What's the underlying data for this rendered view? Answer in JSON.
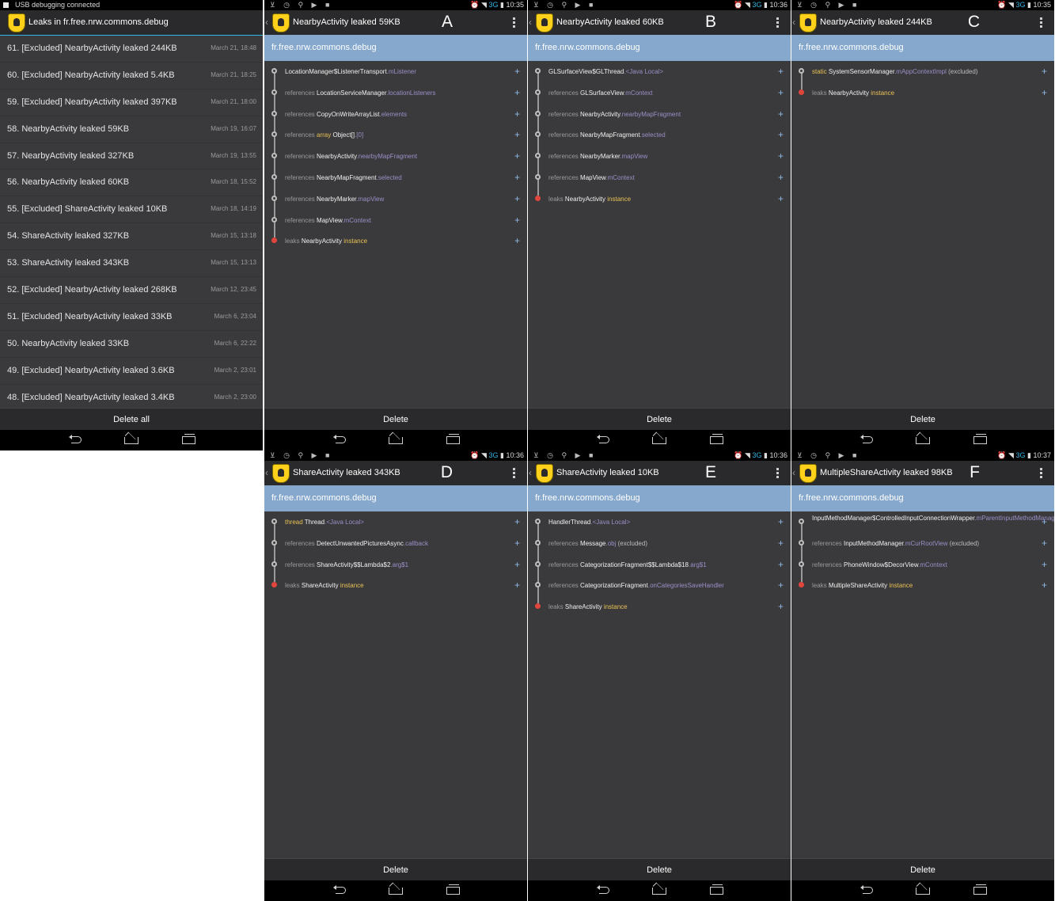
{
  "list_panel": {
    "status_text": "USB debugging connected",
    "title": "Leaks in fr.free.nrw.commons.debug",
    "items": [
      {
        "name": "61. [Excluded] NearbyActivity leaked 244KB",
        "date": "March 21, 18:48"
      },
      {
        "name": "60. [Excluded] NearbyActivity leaked 5.4KB",
        "date": "March 21, 18:25"
      },
      {
        "name": "59. [Excluded] NearbyActivity leaked 397KB",
        "date": "March 21, 18:00"
      },
      {
        "name": "58. NearbyActivity leaked 59KB",
        "date": "March 19, 16:07"
      },
      {
        "name": "57. NearbyActivity leaked 327KB",
        "date": "March 19, 13:55"
      },
      {
        "name": "56. NearbyActivity leaked 60KB",
        "date": "March 18, 15:52"
      },
      {
        "name": "55. [Excluded] ShareActivity leaked 10KB",
        "date": "March 18, 14:19"
      },
      {
        "name": "54. ShareActivity leaked 327KB",
        "date": "March 15, 13:18"
      },
      {
        "name": "53. ShareActivity leaked 343KB",
        "date": "March 15, 13:13"
      },
      {
        "name": "52. [Excluded] NearbyActivity leaked 268KB",
        "date": "March 12, 23:45"
      },
      {
        "name": "51. [Excluded] NearbyActivity leaked 33KB",
        "date": "March 6, 23:04"
      },
      {
        "name": "50. NearbyActivity leaked 33KB",
        "date": "March 6, 22:22"
      },
      {
        "name": "49. [Excluded] NearbyActivity leaked 3.6KB",
        "date": "March 2, 23:01"
      },
      {
        "name": "48. [Excluded] NearbyActivity leaked 3.4KB",
        "date": "March 2, 23:00"
      }
    ],
    "button": "Delete all"
  },
  "package": "fr.free.nrw.commons.debug",
  "delete_label": "Delete",
  "detail_panels": [
    {
      "letter": "A",
      "title": "NearbyActivity leaked 59KB",
      "time": "10:35",
      "rows": [
        [
          {
            "t": "LocationManager$ListenerTransport",
            "c": "cls"
          },
          {
            "t": ".mListener",
            "c": "field"
          }
        ],
        [
          {
            "t": "references ",
            "c": "ref"
          },
          {
            "t": "LocationServiceManager",
            "c": "cls"
          },
          {
            "t": ".locationListeners",
            "c": "field"
          }
        ],
        [
          {
            "t": "references ",
            "c": "ref"
          },
          {
            "t": "CopyOnWriteArrayList",
            "c": "cls"
          },
          {
            "t": ".elements",
            "c": "field"
          }
        ],
        [
          {
            "t": "references ",
            "c": "ref"
          },
          {
            "t": "array ",
            "c": "kw"
          },
          {
            "t": "Object[]",
            "c": "cls"
          },
          {
            "t": ".[0]",
            "c": "field"
          }
        ],
        [
          {
            "t": "references ",
            "c": "ref"
          },
          {
            "t": "NearbyActivity",
            "c": "cls"
          },
          {
            "t": ".nearbyMapFragment",
            "c": "field"
          }
        ],
        [
          {
            "t": "references ",
            "c": "ref"
          },
          {
            "t": "NearbyMapFragment",
            "c": "cls"
          },
          {
            "t": ".selected",
            "c": "field"
          }
        ],
        [
          {
            "t": "references ",
            "c": "ref"
          },
          {
            "t": "NearbyMarker",
            "c": "cls"
          },
          {
            "t": ".mapView",
            "c": "field"
          }
        ],
        [
          {
            "t": "references ",
            "c": "ref"
          },
          {
            "t": "MapView",
            "c": "cls"
          },
          {
            "t": ".mContext",
            "c": "field"
          }
        ],
        [
          {
            "t": "leaks ",
            "c": "ref"
          },
          {
            "t": "NearbyActivity ",
            "c": "cls"
          },
          {
            "t": "instance",
            "c": "inst"
          }
        ]
      ]
    },
    {
      "letter": "B",
      "title": "NearbyActivity leaked 60KB",
      "time": "10:36",
      "rows": [
        [
          {
            "t": "GLSurfaceView$GLThread",
            "c": "cls"
          },
          {
            "t": ".<Java Local>",
            "c": "field"
          }
        ],
        [
          {
            "t": "references ",
            "c": "ref"
          },
          {
            "t": "GLSurfaceView",
            "c": "cls"
          },
          {
            "t": ".mContext",
            "c": "field"
          }
        ],
        [
          {
            "t": "references ",
            "c": "ref"
          },
          {
            "t": "NearbyActivity",
            "c": "cls"
          },
          {
            "t": ".nearbyMapFragment",
            "c": "field"
          }
        ],
        [
          {
            "t": "references ",
            "c": "ref"
          },
          {
            "t": "NearbyMapFragment",
            "c": "cls"
          },
          {
            "t": ".selected",
            "c": "field"
          }
        ],
        [
          {
            "t": "references ",
            "c": "ref"
          },
          {
            "t": "NearbyMarker",
            "c": "cls"
          },
          {
            "t": ".mapView",
            "c": "field"
          }
        ],
        [
          {
            "t": "references ",
            "c": "ref"
          },
          {
            "t": "MapView",
            "c": "cls"
          },
          {
            "t": ".mContext",
            "c": "field"
          }
        ],
        [
          {
            "t": "leaks ",
            "c": "ref"
          },
          {
            "t": "NearbyActivity ",
            "c": "cls"
          },
          {
            "t": "instance",
            "c": "inst"
          }
        ]
      ]
    },
    {
      "letter": "C",
      "title": "NearbyActivity leaked 244KB",
      "time": "10:35",
      "rows": [
        [
          {
            "t": "static ",
            "c": "kw"
          },
          {
            "t": "SystemSensorManager",
            "c": "cls"
          },
          {
            "t": ".mAppContextImpl",
            "c": "field"
          },
          {
            "t": " (excluded)",
            "c": "exc"
          }
        ],
        [
          {
            "t": "leaks ",
            "c": "ref"
          },
          {
            "t": "NearbyActivity ",
            "c": "cls"
          },
          {
            "t": "instance",
            "c": "inst"
          }
        ]
      ]
    },
    {
      "letter": "D",
      "title": "ShareActivity leaked 343KB",
      "time": "10:36",
      "rows": [
        [
          {
            "t": "thread ",
            "c": "kw"
          },
          {
            "t": "Thread",
            "c": "cls"
          },
          {
            "t": ".<Java Local>",
            "c": "field"
          }
        ],
        [
          {
            "t": "references ",
            "c": "ref"
          },
          {
            "t": "DetectUnwantedPicturesAsync",
            "c": "cls"
          },
          {
            "t": ".callback",
            "c": "field"
          }
        ],
        [
          {
            "t": "references ",
            "c": "ref"
          },
          {
            "t": "ShareActivity$$Lambda$2",
            "c": "cls"
          },
          {
            "t": ".arg$1",
            "c": "field"
          }
        ],
        [
          {
            "t": "leaks ",
            "c": "ref"
          },
          {
            "t": "ShareActivity ",
            "c": "cls"
          },
          {
            "t": "instance",
            "c": "inst"
          }
        ]
      ]
    },
    {
      "letter": "E",
      "title": "ShareActivity leaked 10KB",
      "time": "10:36",
      "rows": [
        [
          {
            "t": "HandlerThread",
            "c": "cls"
          },
          {
            "t": ".<Java Local>",
            "c": "field"
          }
        ],
        [
          {
            "t": "references ",
            "c": "ref"
          },
          {
            "t": "Message",
            "c": "cls"
          },
          {
            "t": ".obj",
            "c": "field"
          },
          {
            "t": " (excluded)",
            "c": "exc"
          }
        ],
        [
          {
            "t": "references ",
            "c": "ref"
          },
          {
            "t": "CategorizationFragment$$Lambda$18",
            "c": "cls"
          },
          {
            "t": ".arg$1",
            "c": "field"
          }
        ],
        [
          {
            "t": "references ",
            "c": "ref"
          },
          {
            "t": "CategorizationFragment",
            "c": "cls"
          },
          {
            "t": ".onCategoriesSaveHandler",
            "c": "field"
          }
        ],
        [
          {
            "t": "leaks ",
            "c": "ref"
          },
          {
            "t": "ShareActivity ",
            "c": "cls"
          },
          {
            "t": "instance",
            "c": "inst"
          }
        ]
      ]
    },
    {
      "letter": "F",
      "title": "MultipleShareActivity leaked 98KB",
      "time": "10:37",
      "rows": [
        [
          {
            "t": "InputMethodManager$ControlledInputConnectionWrapper",
            "c": "cls"
          },
          {
            "t": ".mParentInputMethodManager",
            "c": "field"
          }
        ],
        [
          {
            "t": "references ",
            "c": "ref"
          },
          {
            "t": "InputMethodManager",
            "c": "cls"
          },
          {
            "t": ".mCurRootView",
            "c": "field"
          },
          {
            "t": " (excluded)",
            "c": "exc"
          }
        ],
        [
          {
            "t": "references ",
            "c": "ref"
          },
          {
            "t": "PhoneWindow$DecorView",
            "c": "cls"
          },
          {
            "t": ".mContext",
            "c": "field"
          }
        ],
        [
          {
            "t": "leaks ",
            "c": "ref"
          },
          {
            "t": "MultipleShareActivity ",
            "c": "cls"
          },
          {
            "t": "instance",
            "c": "inst"
          }
        ]
      ]
    }
  ],
  "status_icons": {
    "left": "⊻ ◷ ⚲ ▶ ■",
    "right": "⏰ ◥",
    "network": "3G"
  },
  "colors": {
    "accent": "#33b5e5",
    "package_bar": "#86a8cc",
    "leak_node": "#e0463c"
  }
}
